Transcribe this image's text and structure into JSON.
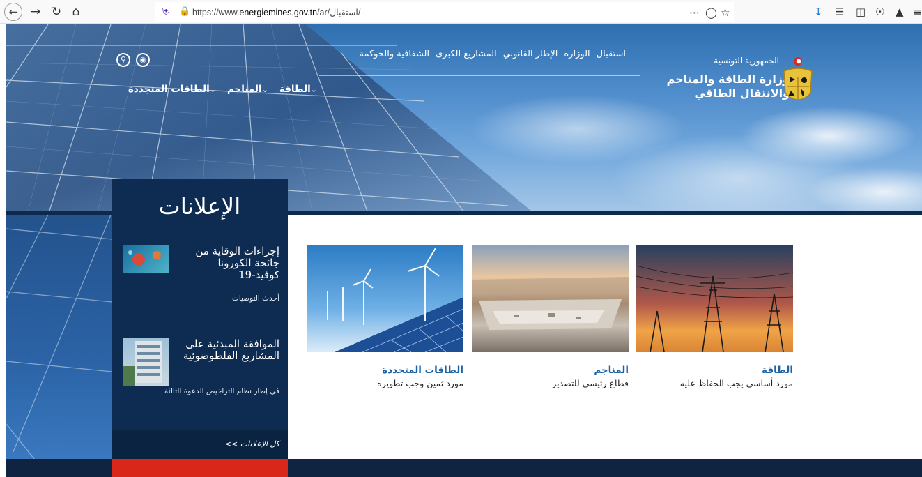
{
  "browser": {
    "url_prefix": "https://www.",
    "url_domain": "energiemines.gov.tn",
    "url_path": "/ar/استقبال/",
    "more_icon": "more-horizontal-icon",
    "pocket_icon": "pocket-icon",
    "star_icon": "bookmark-star-icon"
  },
  "nav": {
    "top_items": [
      "استقبال",
      "الوزارة",
      "الإطار القانوني",
      "المشاريع الكبرى",
      "الشفافية والحوكمة"
    ],
    "main_items": [
      "الطاقة",
      "المناجم",
      "الطاقات المتجددة"
    ]
  },
  "logo": {
    "line1": "الجمهورية التونسية",
    "line2": "وزارة الطاقة والمناجم",
    "line3": "والانتقال الطاقي"
  },
  "announcements": {
    "title": "الإعلانات",
    "items": [
      {
        "title": "إجراءات الوقاية من جائحة الكورونا كوفيد-19",
        "subtitle": "أحدث التوصيات"
      },
      {
        "title": "الموافقة المبدئية على المشاريع الفلطوضوئية",
        "subtitle": "في إطار نظام التراخيص الدعوة الثالثة"
      }
    ],
    "all_link": "كل الإعلانات >>"
  },
  "cards": [
    {
      "title": "الطاقة",
      "description": "مورد أساسي يجب الحفاظ عليه"
    },
    {
      "title": "المناجم",
      "description": "قطاع رئيسي للتصدير"
    },
    {
      "title": "الطاقات المتجددة",
      "description": "مورد ثمين وجب تطويره"
    }
  ],
  "colors": {
    "nav_dark": "#0e2c52",
    "accent_red": "#d9281a",
    "link_blue": "#1c63a8"
  }
}
